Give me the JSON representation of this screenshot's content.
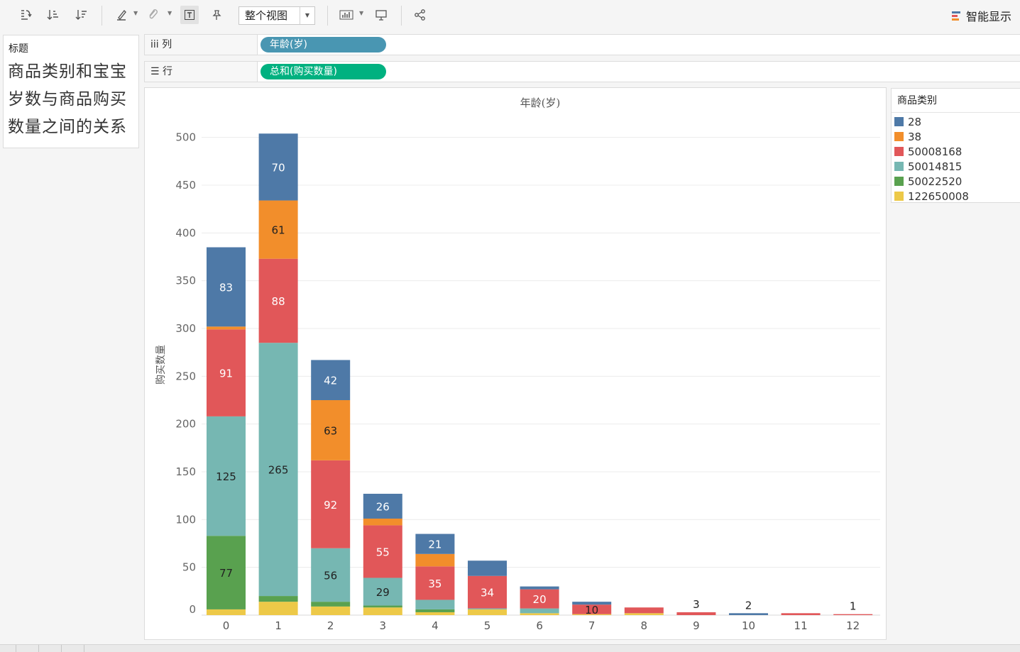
{
  "toolbar": {
    "icons": [
      "swap-axes-icon",
      "sort-ascending-icon",
      "sort-descending-icon",
      "highlight-icon",
      "group-icon",
      "show-labels-icon",
      "pin-axis-icon",
      "show-me-chart-icon",
      "presentation-icon",
      "share-icon"
    ],
    "view_select": "整个视图",
    "smart_display": "智能显示"
  },
  "title_card": {
    "header": "标题",
    "text": "商品类别和宝宝岁数与商品购买数量之间的关系"
  },
  "shelves": {
    "columns": {
      "label": "iii 列",
      "pill": "年龄(岁)",
      "pill_color": "#4996b2"
    },
    "rows": {
      "label": "☰ 行",
      "pill": "总和(购买数量)",
      "pill_color": "#00b180"
    }
  },
  "legend": {
    "header": "商品类别",
    "items": [
      {
        "label": "28",
        "color": "#4e79a7"
      },
      {
        "label": "38",
        "color": "#f28e2b"
      },
      {
        "label": "50008168",
        "color": "#e15759"
      },
      {
        "label": "50014815",
        "color": "#76b7b2"
      },
      {
        "label": "50022520",
        "color": "#59a14f"
      },
      {
        "label": "122650008",
        "color": "#edc948"
      }
    ]
  },
  "chart_data": {
    "type": "bar",
    "stacked": true,
    "title": "年龄(岁)",
    "ylabel": "购买数量",
    "xlabel": "",
    "ylim": [
      0,
      525
    ],
    "yticks": [
      0,
      50,
      100,
      150,
      200,
      250,
      300,
      350,
      400,
      450,
      500
    ],
    "categories": [
      "0",
      "1",
      "2",
      "3",
      "4",
      "5",
      "6",
      "7",
      "8",
      "9",
      "10",
      "11",
      "12"
    ],
    "stack_order": [
      "122650008",
      "50022520",
      "50014815",
      "50008168",
      "38",
      "28"
    ],
    "series": [
      {
        "name": "122650008",
        "color": "#edc948",
        "values": [
          6,
          14,
          9,
          8,
          3,
          6,
          2,
          1,
          2,
          0,
          0,
          0,
          0
        ],
        "labels": [
          null,
          null,
          null,
          null,
          null,
          null,
          null,
          null,
          null,
          null,
          null,
          null,
          null
        ]
      },
      {
        "name": "50022520",
        "color": "#59a14f",
        "values": [
          77,
          6,
          5,
          2,
          3,
          0,
          0,
          0,
          0,
          0,
          0,
          0,
          0
        ],
        "labels": [
          77,
          null,
          null,
          null,
          null,
          null,
          null,
          null,
          null,
          null,
          null,
          null,
          null
        ]
      },
      {
        "name": "50014815",
        "color": "#76b7b2",
        "values": [
          125,
          265,
          56,
          29,
          10,
          1,
          5,
          0,
          0,
          0,
          0,
          0,
          0
        ],
        "labels": [
          125,
          265,
          56,
          29,
          null,
          null,
          null,
          null,
          null,
          null,
          null,
          null,
          null
        ]
      },
      {
        "name": "50008168",
        "color": "#e15759",
        "values": [
          91,
          88,
          92,
          55,
          35,
          34,
          20,
          10,
          6,
          3,
          0,
          2,
          1
        ],
        "labels": [
          91,
          88,
          92,
          55,
          35,
          34,
          20,
          10,
          null,
          3,
          null,
          null,
          1
        ]
      },
      {
        "name": "38",
        "color": "#f28e2b",
        "values": [
          3,
          61,
          63,
          7,
          13,
          0,
          0,
          0,
          0,
          0,
          0,
          0,
          0
        ],
        "labels": [
          null,
          61,
          63,
          null,
          null,
          null,
          null,
          null,
          null,
          null,
          null,
          null,
          null
        ]
      },
      {
        "name": "28",
        "color": "#4e79a7",
        "values": [
          83,
          70,
          42,
          26,
          21,
          16,
          3,
          3,
          0,
          0,
          2,
          0,
          0
        ],
        "labels": [
          83,
          70,
          42,
          26,
          21,
          null,
          null,
          null,
          null,
          null,
          2,
          null,
          null
        ]
      }
    ],
    "grid": true,
    "legend_position": "right"
  }
}
